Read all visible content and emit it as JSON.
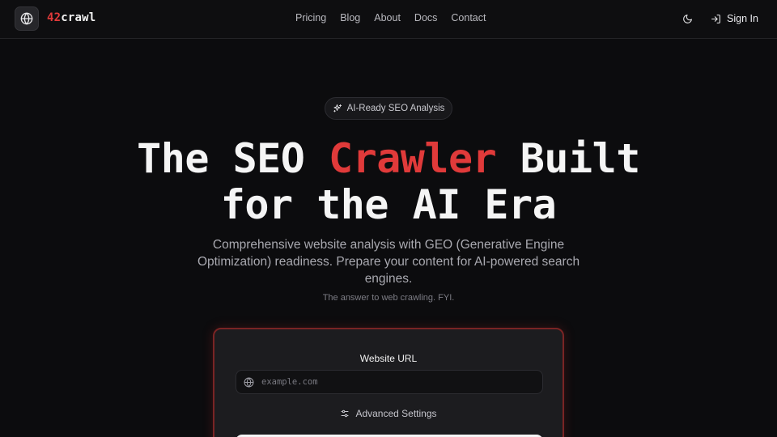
{
  "header": {
    "brand_number": "42",
    "brand_word": "crawl",
    "logo_icon": "globe-icon",
    "nav": [
      {
        "label": "Pricing"
      },
      {
        "label": "Blog"
      },
      {
        "label": "About"
      },
      {
        "label": "Docs"
      },
      {
        "label": "Contact"
      }
    ],
    "theme_icon": "moon-icon",
    "signin_label": "Sign In",
    "signin_icon": "sign-in-icon"
  },
  "hero": {
    "badge_icon": "sparkles-icon",
    "badge_label": "AI-Ready SEO Analysis",
    "headline_part1": "The SEO ",
    "headline_accent": "Crawler",
    "headline_part2": " Built",
    "headline_line2": "for the AI Era",
    "subtitle": "Comprehensive website analysis with GEO (Generative Engine Optimization) readiness. Prepare your content for AI-powered search engines.",
    "tagline": "The answer to web crawling. FYI."
  },
  "form": {
    "url_label": "Website URL",
    "url_placeholder": "example.com",
    "url_value": "",
    "url_icon": "globe-icon",
    "advanced_label": "Advanced Settings",
    "advanced_icon": "sliders-icon"
  },
  "colors": {
    "accent": "#e03a3a",
    "background": "#0c0c0e",
    "card": "#1c1c1f",
    "card_border": "#7a2424"
  }
}
